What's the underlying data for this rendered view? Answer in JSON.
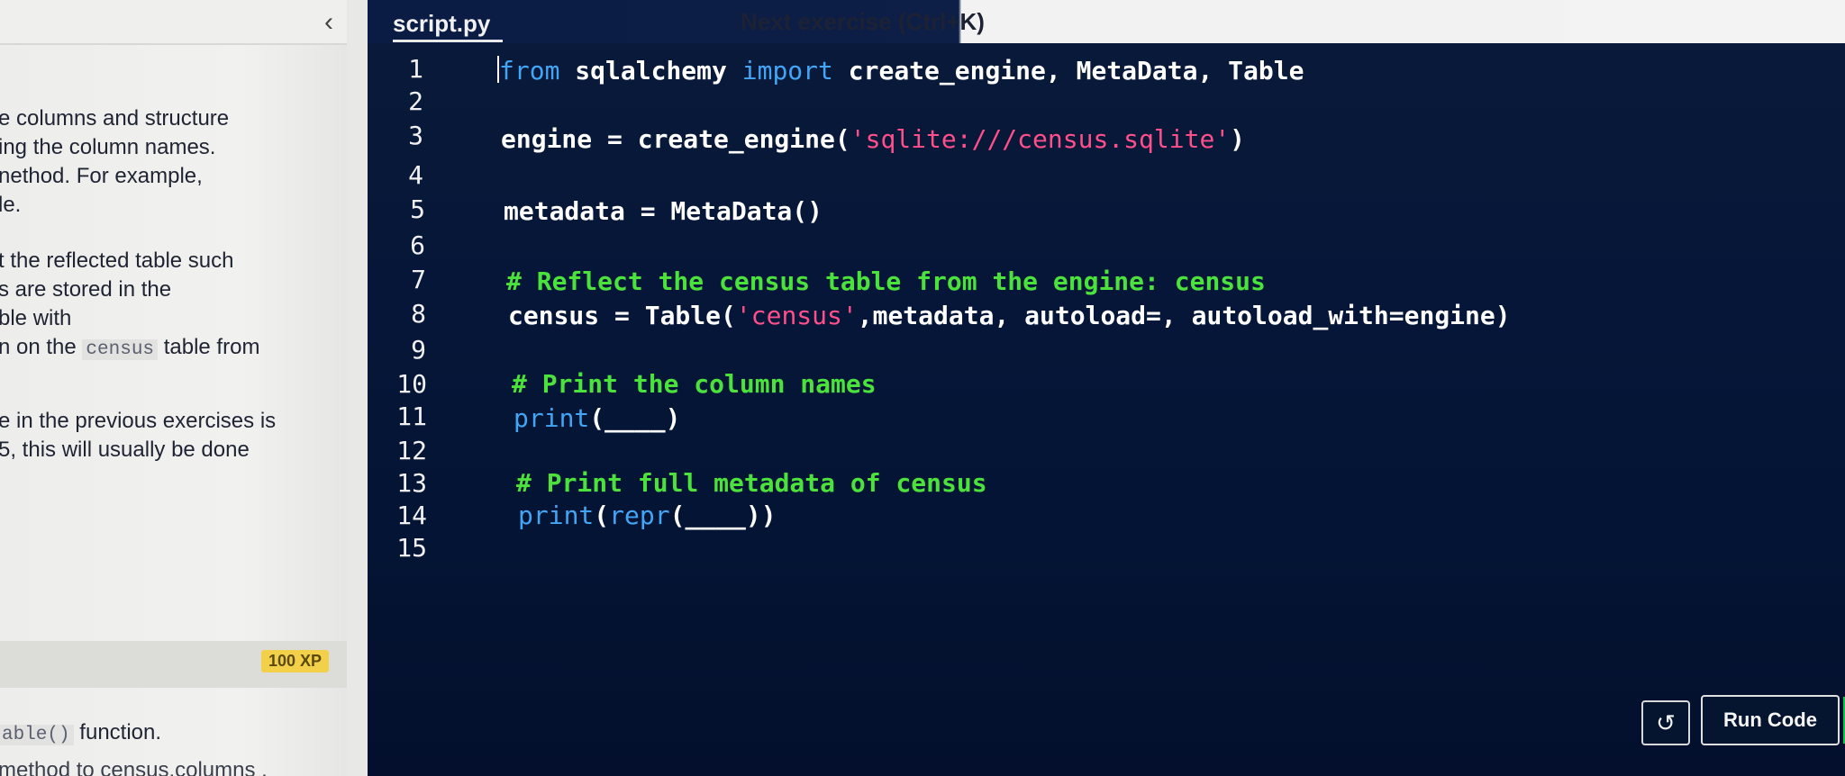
{
  "left_panel": {
    "collapse_glyph": "‹",
    "context_lines": [
      "e columns and structure",
      "ing the column names.",
      "nethod. For example,",
      "le.",
      "t the reflected table such",
      "s are stored in the",
      "ble with",
      "n on the",
      "table from",
      "e in the previous exercises is",
      "5, this will usually be done"
    ],
    "inline_code_census": "census",
    "xp_badge": "100 XP",
    "task_code": "able()",
    "task_text": "function.",
    "task_partial": "method to  census.columns ."
  },
  "editor": {
    "tab_title": "script.py",
    "next_exercise": "Next exercise (Ctrl+K)",
    "line_numbers": [
      "1",
      "2",
      "3",
      "4",
      "5",
      "6",
      "7",
      "8",
      "9",
      "10",
      "11",
      "12",
      "13",
      "14",
      "15"
    ],
    "lines": {
      "l1_from": "from",
      "l1_mid": " sqlalchemy ",
      "l1_import": "import",
      "l1_rest": " create_engine, MetaData, Table",
      "l3_a": "engine = create_engine(",
      "l3_str": "'sqlite:///census.sqlite'",
      "l3_b": ")",
      "l5": "metadata = MetaData()",
      "l7": "# Reflect the census table from the engine: census",
      "l8_a": "census = Table(",
      "l8_str": "'census'",
      "l8_b": ",metadata, autoload=, autoload_with=engine)",
      "l10": "# Print the column names",
      "l11_fn": "print",
      "l11_rest": "(____)",
      "l13": "# Print full metadata of census",
      "l14_fn1": "print",
      "l14_p": "(",
      "l14_fn2": "repr",
      "l14_rest": "(____))"
    }
  },
  "buttons": {
    "reset_glyph": "↺",
    "run_code": "Run Code"
  },
  "colors": {
    "keyword": "#42a5f5",
    "string": "#ff4f8a",
    "comment": "#4be23c",
    "editor_bg": "#051638",
    "xp_badge": "#f2d04a",
    "run_accent": "#0ec64f"
  }
}
